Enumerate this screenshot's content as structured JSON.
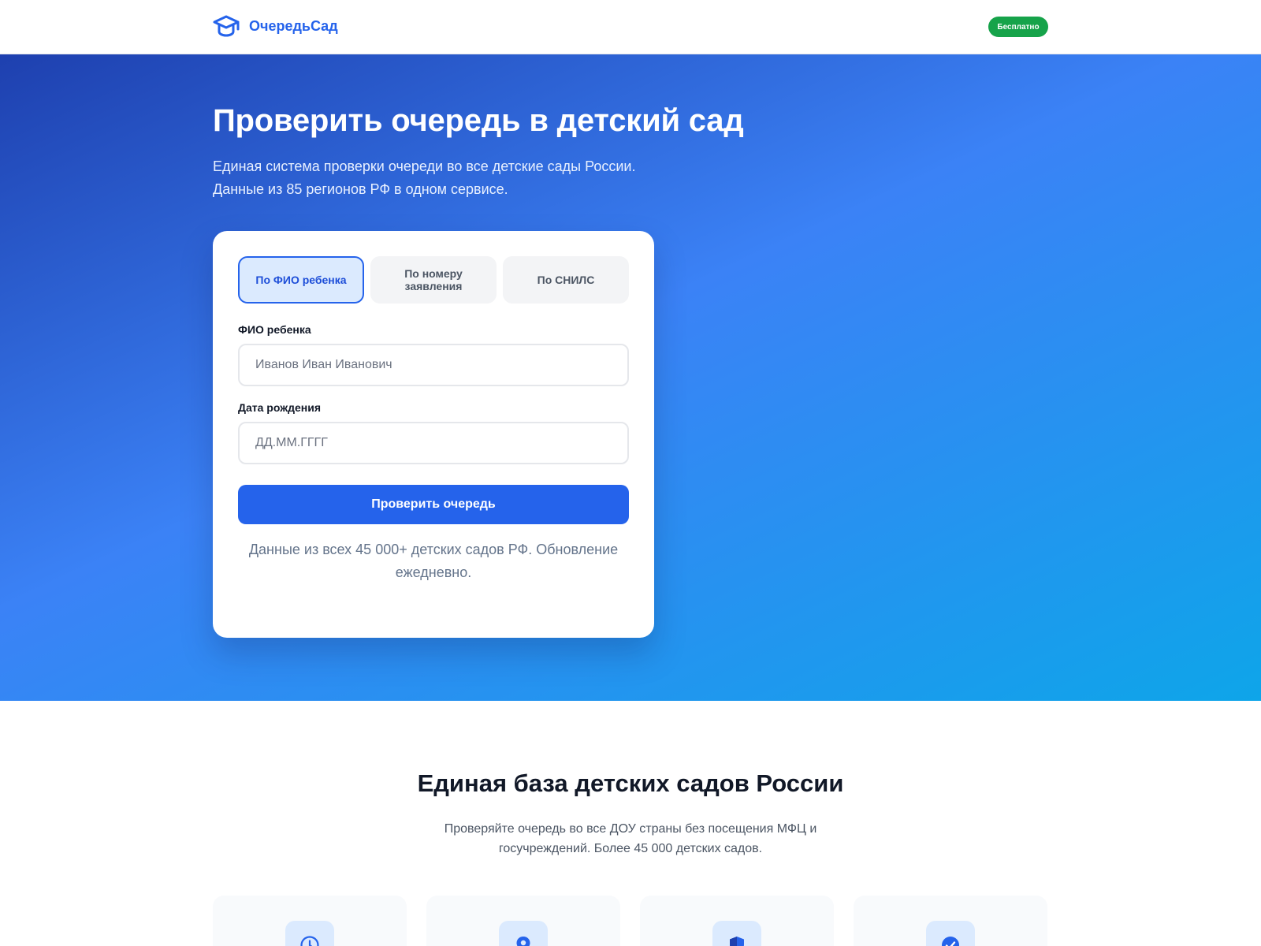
{
  "header": {
    "logo_text": "ОчередьСад",
    "badge": "Бесплатно"
  },
  "hero": {
    "title": "Проверить очередь в детский сад",
    "subtitle_line1": "Единая система проверки очереди во все детские сады России.",
    "subtitle_line2": "Данные из 85 регионов РФ в одном сервисе."
  },
  "form": {
    "tabs": [
      {
        "label": "По ФИО ребенка",
        "active": true
      },
      {
        "label": "По номеру заявления",
        "active": false
      },
      {
        "label": "По СНИЛС",
        "active": false
      }
    ],
    "fio": {
      "label": "ФИО ребенка",
      "placeholder": "Иванов Иван Иванович",
      "value": ""
    },
    "birthdate": {
      "label": "Дата рождения",
      "placeholder": "ДД.ММ.ГГГГ",
      "value": ""
    },
    "submit_label": "Проверить очередь",
    "note": "Данные из всех 45 000+ детских садов РФ. Обновление ежедневно."
  },
  "section": {
    "title": "Единая база детских садов России",
    "subtitle": "Проверяйте очередь во все ДОУ страны без посещения МФЦ и госучреждений. Более 45 000 детских садов."
  },
  "features": [
    {
      "icon": "clock-icon"
    },
    {
      "icon": "map-pin-icon"
    },
    {
      "icon": "shield-icon"
    },
    {
      "icon": "check-circle-icon"
    }
  ],
  "colors": {
    "brand": "#2563eb",
    "badge": "#16a34a",
    "hero_gradient_start": "#1e40af",
    "hero_gradient_end": "#0ea5e9"
  }
}
